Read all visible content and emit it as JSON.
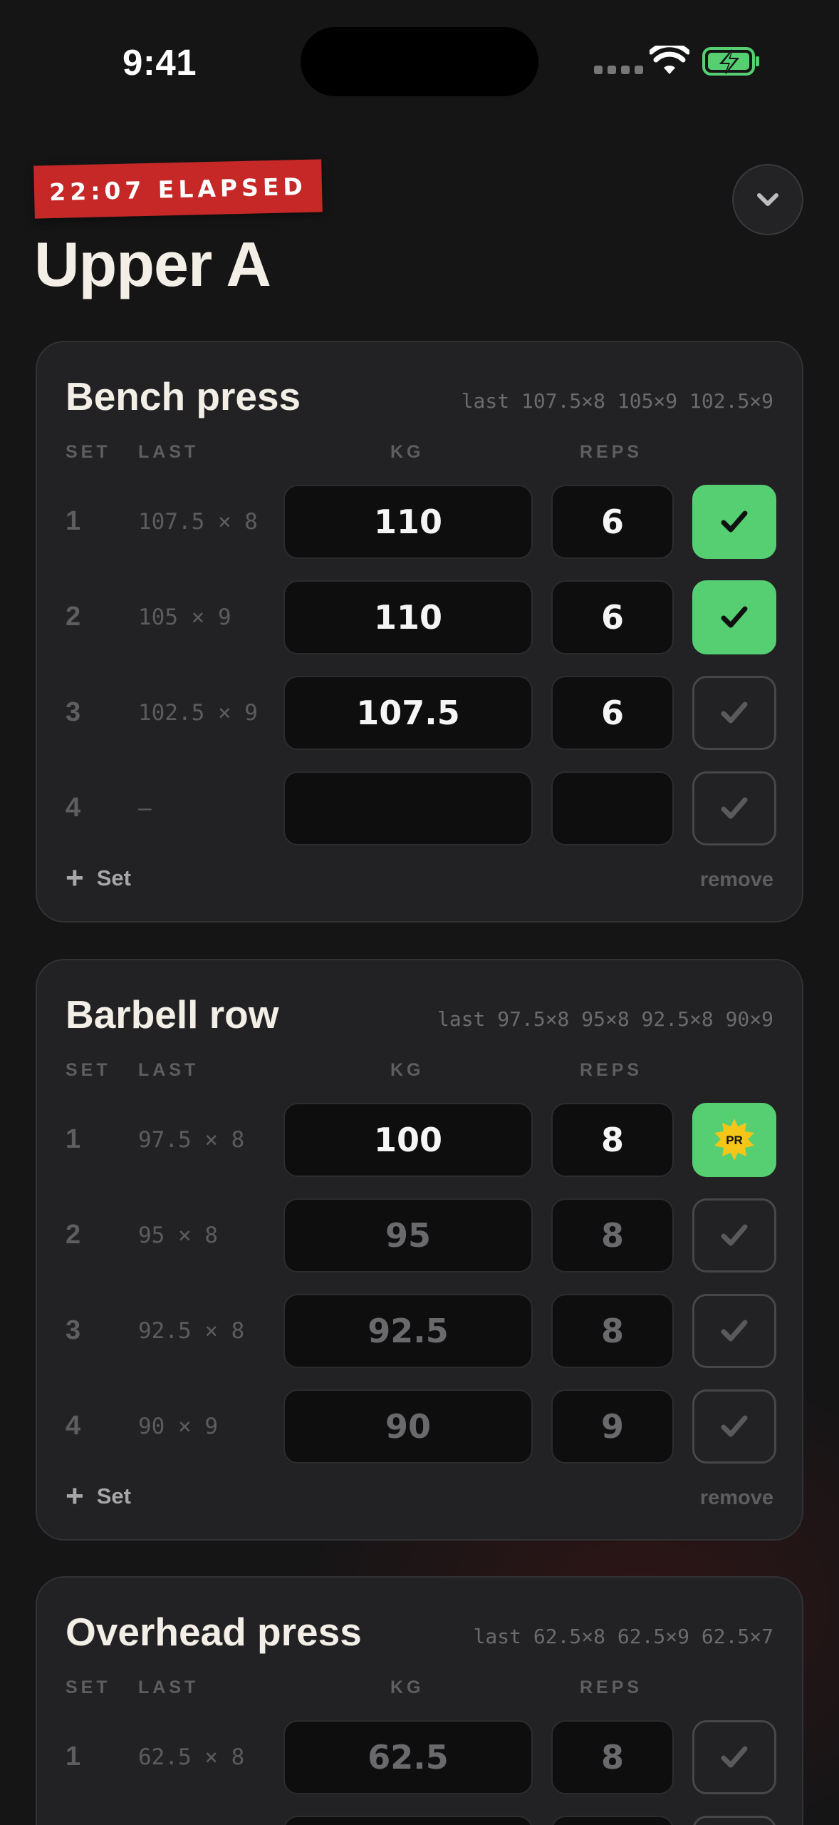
{
  "status": {
    "time": "9:41"
  },
  "header": {
    "elapsed": "22:07 ELAPSED",
    "title": "Upper A"
  },
  "columns": {
    "set": "SET",
    "last": "LAST",
    "kg": "KG",
    "reps": "REPS"
  },
  "actions": {
    "add_set": "Set",
    "remove": "remove"
  },
  "colors": {
    "accent_red": "#c62828",
    "done_green": "#56cf72",
    "pr_badge": "#f5c518"
  },
  "exercises": [
    {
      "name": "Bench press",
      "last_summary": "last 107.5×8 105×9 102.5×9",
      "sets": [
        {
          "n": "1",
          "last": "107.5 × 8",
          "kg": "110",
          "reps": "6",
          "status": "done"
        },
        {
          "n": "2",
          "last": "105 × 9",
          "kg": "110",
          "reps": "6",
          "status": "done"
        },
        {
          "n": "3",
          "last": "102.5 × 9",
          "kg": "107.5",
          "reps": "6",
          "status": "pending"
        },
        {
          "n": "4",
          "last": "—",
          "kg": "",
          "reps": "",
          "status": "pending"
        }
      ]
    },
    {
      "name": "Barbell row",
      "last_summary": "last 97.5×8 95×8 92.5×8 90×9",
      "sets": [
        {
          "n": "1",
          "last": "97.5 × 8",
          "kg": "100",
          "reps": "8",
          "status": "pr",
          "badge": "PR"
        },
        {
          "n": "2",
          "last": "95 × 8",
          "kg": "95",
          "reps": "8",
          "status": "pending"
        },
        {
          "n": "3",
          "last": "92.5 × 8",
          "kg": "92.5",
          "reps": "8",
          "status": "pending"
        },
        {
          "n": "4",
          "last": "90 × 9",
          "kg": "90",
          "reps": "9",
          "status": "pending"
        }
      ]
    },
    {
      "name": "Overhead press",
      "last_summary": "last 62.5×8 62.5×9 62.5×7",
      "sets": [
        {
          "n": "1",
          "last": "62.5 × 8",
          "kg": "62.5",
          "reps": "8",
          "status": "pending"
        }
      ]
    }
  ]
}
